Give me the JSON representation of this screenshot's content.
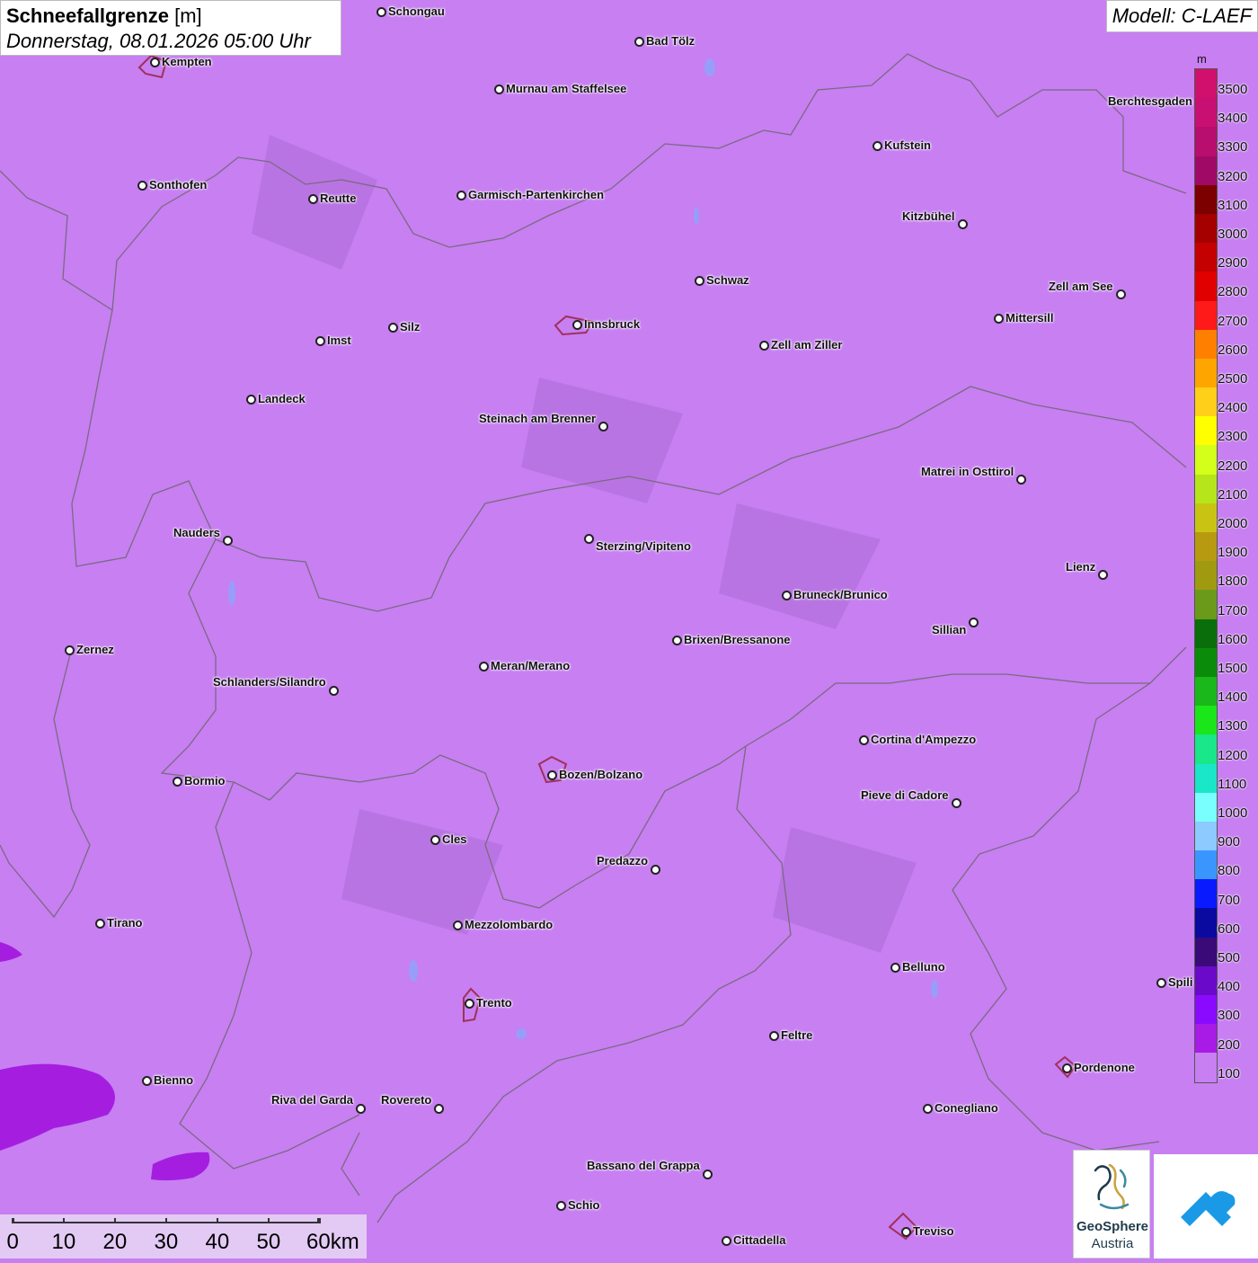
{
  "title": {
    "main": "Schneefallgrenze",
    "unit": "[m]",
    "datetime": "Donnerstag, 08.01.2026 05:00 Uhr"
  },
  "model": "Modell: C-LAEF",
  "legend": {
    "unit": "m",
    "entries": [
      {
        "label": "3500",
        "color": "#d1106e"
      },
      {
        "label": "3400",
        "color": "#c80f72"
      },
      {
        "label": "3300",
        "color": "#b80e6e"
      },
      {
        "label": "3200",
        "color": "#a00a66"
      },
      {
        "label": "3100",
        "color": "#7c0000"
      },
      {
        "label": "3000",
        "color": "#a50000"
      },
      {
        "label": "2900",
        "color": "#c40000"
      },
      {
        "label": "2800",
        "color": "#e10000"
      },
      {
        "label": "2700",
        "color": "#ff1a1a"
      },
      {
        "label": "2600",
        "color": "#ff8000"
      },
      {
        "label": "2500",
        "color": "#ffa500"
      },
      {
        "label": "2400",
        "color": "#ffcf1a"
      },
      {
        "label": "2300",
        "color": "#ffff00"
      },
      {
        "label": "2200",
        "color": "#d4ff1a"
      },
      {
        "label": "2100",
        "color": "#b5e51a"
      },
      {
        "label": "2000",
        "color": "#c8c414"
      },
      {
        "label": "1900",
        "color": "#b89a10"
      },
      {
        "label": "1800",
        "color": "#a09a10"
      },
      {
        "label": "1700",
        "color": "#6b9a1a"
      },
      {
        "label": "1600",
        "color": "#0a6e0a"
      },
      {
        "label": "1500",
        "color": "#0a8c0a"
      },
      {
        "label": "1400",
        "color": "#1ab81a"
      },
      {
        "label": "1300",
        "color": "#1ae61a"
      },
      {
        "label": "1200",
        "color": "#1ae68a"
      },
      {
        "label": "1100",
        "color": "#1ae6c8"
      },
      {
        "label": "1000",
        "color": "#7affff"
      },
      {
        "label": "900",
        "color": "#8ccaff"
      },
      {
        "label": "800",
        "color": "#3a96ff"
      },
      {
        "label": "700",
        "color": "#0a1aff"
      },
      {
        "label": "600",
        "color": "#0a0aa0"
      },
      {
        "label": "500",
        "color": "#3a0a78"
      },
      {
        "label": "400",
        "color": "#6a0ac8"
      },
      {
        "label": "300",
        "color": "#8a0aff"
      },
      {
        "label": "200",
        "color": "#a81ae6"
      },
      {
        "label": "100",
        "color": "#c77ff2"
      }
    ]
  },
  "cities": [
    {
      "name": "Schongau"
    },
    {
      "name": "Kempten"
    },
    {
      "name": "Bad Tölz"
    },
    {
      "name": "Murnau am Staffelsee"
    },
    {
      "name": "Sonthofen"
    },
    {
      "name": "Reutte"
    },
    {
      "name": "Garmisch-Partenkirchen"
    },
    {
      "name": "Kufstein"
    },
    {
      "name": "Berchtesgaden"
    },
    {
      "name": "Kitzbühel"
    },
    {
      "name": "Schwaz"
    },
    {
      "name": "Zell am See"
    },
    {
      "name": "Mittersill"
    },
    {
      "name": "Innsbruck"
    },
    {
      "name": "Silz"
    },
    {
      "name": "Imst"
    },
    {
      "name": "Zell am Ziller"
    },
    {
      "name": "Landeck"
    },
    {
      "name": "Steinach am Brenner"
    },
    {
      "name": "Matrei in Osttirol"
    },
    {
      "name": "Nauders"
    },
    {
      "name": "Sterzing/Vipiteno"
    },
    {
      "name": "Lienz"
    },
    {
      "name": "Bruneck/Brunico"
    },
    {
      "name": "Sillian"
    },
    {
      "name": "Zernez"
    },
    {
      "name": "Brixen/Bressanone"
    },
    {
      "name": "Meran/Merano"
    },
    {
      "name": "Schlanders/Silandro"
    },
    {
      "name": "Cortina d'Ampezzo"
    },
    {
      "name": "Bozen/Bolzano"
    },
    {
      "name": "Bormio"
    },
    {
      "name": "Pieve di Cadore"
    },
    {
      "name": "Cles"
    },
    {
      "name": "Predazzo"
    },
    {
      "name": "Tirano"
    },
    {
      "name": "Mezzolombardo"
    },
    {
      "name": "Belluno"
    },
    {
      "name": "Spili"
    },
    {
      "name": "Trento"
    },
    {
      "name": "Feltre"
    },
    {
      "name": "Pordenone"
    },
    {
      "name": "Bienno"
    },
    {
      "name": "Riva del Garda"
    },
    {
      "name": "Rovereto"
    },
    {
      "name": "Conegliano"
    },
    {
      "name": "Bassano del Grappa"
    },
    {
      "name": "Schio"
    },
    {
      "name": "Treviso"
    },
    {
      "name": "Cittadella"
    }
  ],
  "scale": {
    "labels": [
      "0",
      "10",
      "20",
      "30",
      "40",
      "50",
      "60km"
    ]
  },
  "logo": {
    "name": "GeoSphere",
    "sub": "Austria"
  }
}
